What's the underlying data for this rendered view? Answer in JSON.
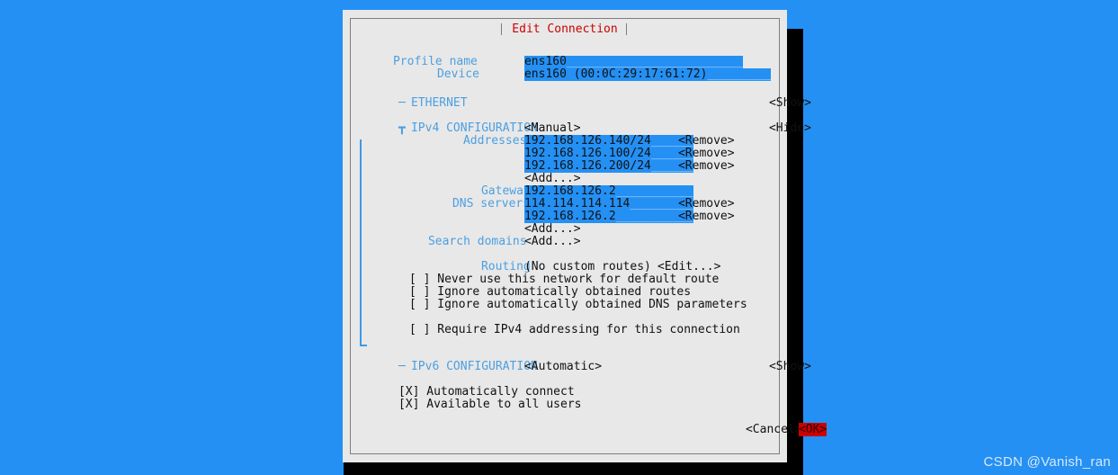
{
  "window": {
    "title": "Edit Connection"
  },
  "profile": {
    "name_label": "Profile name",
    "name_value": "ens160",
    "name_fill": "_________________________",
    "device_label": "Device",
    "device_value": "ens160 (00:0C:29:17:61:72)",
    "device_fill": "_________"
  },
  "ethernet": {
    "marker": "─",
    "title": "ETHERNET",
    "toggle": "<Show>"
  },
  "ipv4": {
    "marker": "┳",
    "title": "IPv4 CONFIGURATION",
    "method": "<Manual>",
    "toggle": "<Hide>",
    "addresses_label": "Addresses",
    "addresses": [
      {
        "value": "192.168.126.140/24",
        "fill": "______",
        "remove": "<Remove>"
      },
      {
        "value": "192.168.126.100/24",
        "fill": "______",
        "remove": "<Remove>"
      },
      {
        "value": "192.168.126.200/24",
        "fill": "______",
        "remove": "<Remove>"
      }
    ],
    "addresses_add": "<Add...>",
    "gateway_label": "Gateway",
    "gateway_value": "192.168.126.2",
    "gateway_fill": "___________",
    "dns_label": "DNS servers",
    "dns": [
      {
        "value": "114.114.114.114",
        "fill": "_________",
        "remove": "<Remove>"
      },
      {
        "value": "192.168.126.2",
        "fill": "___________",
        "remove": "<Remove>"
      }
    ],
    "dns_add": "<Add...>",
    "search_domains_label": "Search domains",
    "search_domains_add": "<Add...>",
    "routing_label": "Routing",
    "routing_value": "(No custom routes)",
    "routing_edit": "<Edit...>",
    "checkboxes": [
      {
        "box": "[ ]",
        "label": "Never use this network for default route"
      },
      {
        "box": "[ ]",
        "label": "Ignore automatically obtained routes"
      },
      {
        "box": "[ ]",
        "label": "Ignore automatically obtained DNS parameters"
      }
    ],
    "require_box": "[ ]",
    "require_label": "Require IPv4 addressing for this connection"
  },
  "ipv6": {
    "marker": "─",
    "title": "IPv6 CONFIGURATION",
    "method": "<Automatic>",
    "toggle": "<Show>"
  },
  "options": [
    {
      "box": "[X]",
      "label": "Automatically connect"
    },
    {
      "box": "[X]",
      "label": "Available to all users"
    }
  ],
  "buttons": {
    "cancel": "<Cancel>",
    "ok": "<OK>"
  },
  "watermark": "CSDN @Vanish_ran"
}
